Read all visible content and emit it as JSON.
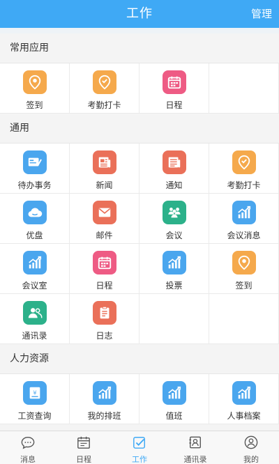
{
  "header": {
    "title": "工作",
    "manage_label": "管理"
  },
  "sections": {
    "common": {
      "title": "常用应用",
      "items": [
        {
          "label": "签到",
          "icon": "location-pin-icon",
          "color": "#f5a94c"
        },
        {
          "label": "考勤打卡",
          "icon": "check-badge-icon",
          "color": "#f5a94c"
        },
        {
          "label": "日程",
          "icon": "calendar-icon",
          "color": "#ee5b84"
        }
      ]
    },
    "general": {
      "title": "通用",
      "items": [
        {
          "label": "待办事务",
          "icon": "todo-card-icon",
          "color": "#4aa6ee"
        },
        {
          "label": "新闻",
          "icon": "newspaper-icon",
          "color": "#ea7059"
        },
        {
          "label": "通知",
          "icon": "notice-icon",
          "color": "#ea7059"
        },
        {
          "label": "考勤打卡",
          "icon": "check-badge-icon",
          "color": "#f5a94c"
        },
        {
          "label": "优盘",
          "icon": "cloud-icon",
          "color": "#4aa6ee"
        },
        {
          "label": "邮件",
          "icon": "mail-icon",
          "color": "#ea7059"
        },
        {
          "label": "会议",
          "icon": "meeting-icon",
          "color": "#2cb18a"
        },
        {
          "label": "会议消息",
          "icon": "chart-icon",
          "color": "#4aa6ee"
        },
        {
          "label": "会议室",
          "icon": "chart-icon",
          "color": "#4aa6ee"
        },
        {
          "label": "日程",
          "icon": "calendar-icon",
          "color": "#ee5b84"
        },
        {
          "label": "投票",
          "icon": "chart-icon",
          "color": "#4aa6ee"
        },
        {
          "label": "签到",
          "icon": "location-pin-icon",
          "color": "#f5a94c"
        },
        {
          "label": "通讯录",
          "icon": "contacts-icon",
          "color": "#2cb18a"
        },
        {
          "label": "日志",
          "icon": "log-icon",
          "color": "#ea7059"
        }
      ]
    },
    "hr": {
      "title": "人力资源",
      "items": [
        {
          "label": "工资查询",
          "icon": "salary-icon",
          "color": "#4aa6ee"
        },
        {
          "label": "我的排班",
          "icon": "chart-icon",
          "color": "#4aa6ee"
        },
        {
          "label": "值班",
          "icon": "chart-icon",
          "color": "#4aa6ee"
        },
        {
          "label": "人事档案",
          "icon": "chart-icon",
          "color": "#4aa6ee"
        }
      ]
    }
  },
  "tabbar": {
    "items": [
      {
        "label": "消息",
        "icon": "message-icon"
      },
      {
        "label": "日程",
        "icon": "calendar-icon"
      },
      {
        "label": "工作",
        "icon": "work-icon"
      },
      {
        "label": "通讯录",
        "icon": "address-book-icon"
      },
      {
        "label": "我的",
        "icon": "profile-icon"
      }
    ],
    "active_index": 2,
    "active_color": "#3fa9f5"
  }
}
